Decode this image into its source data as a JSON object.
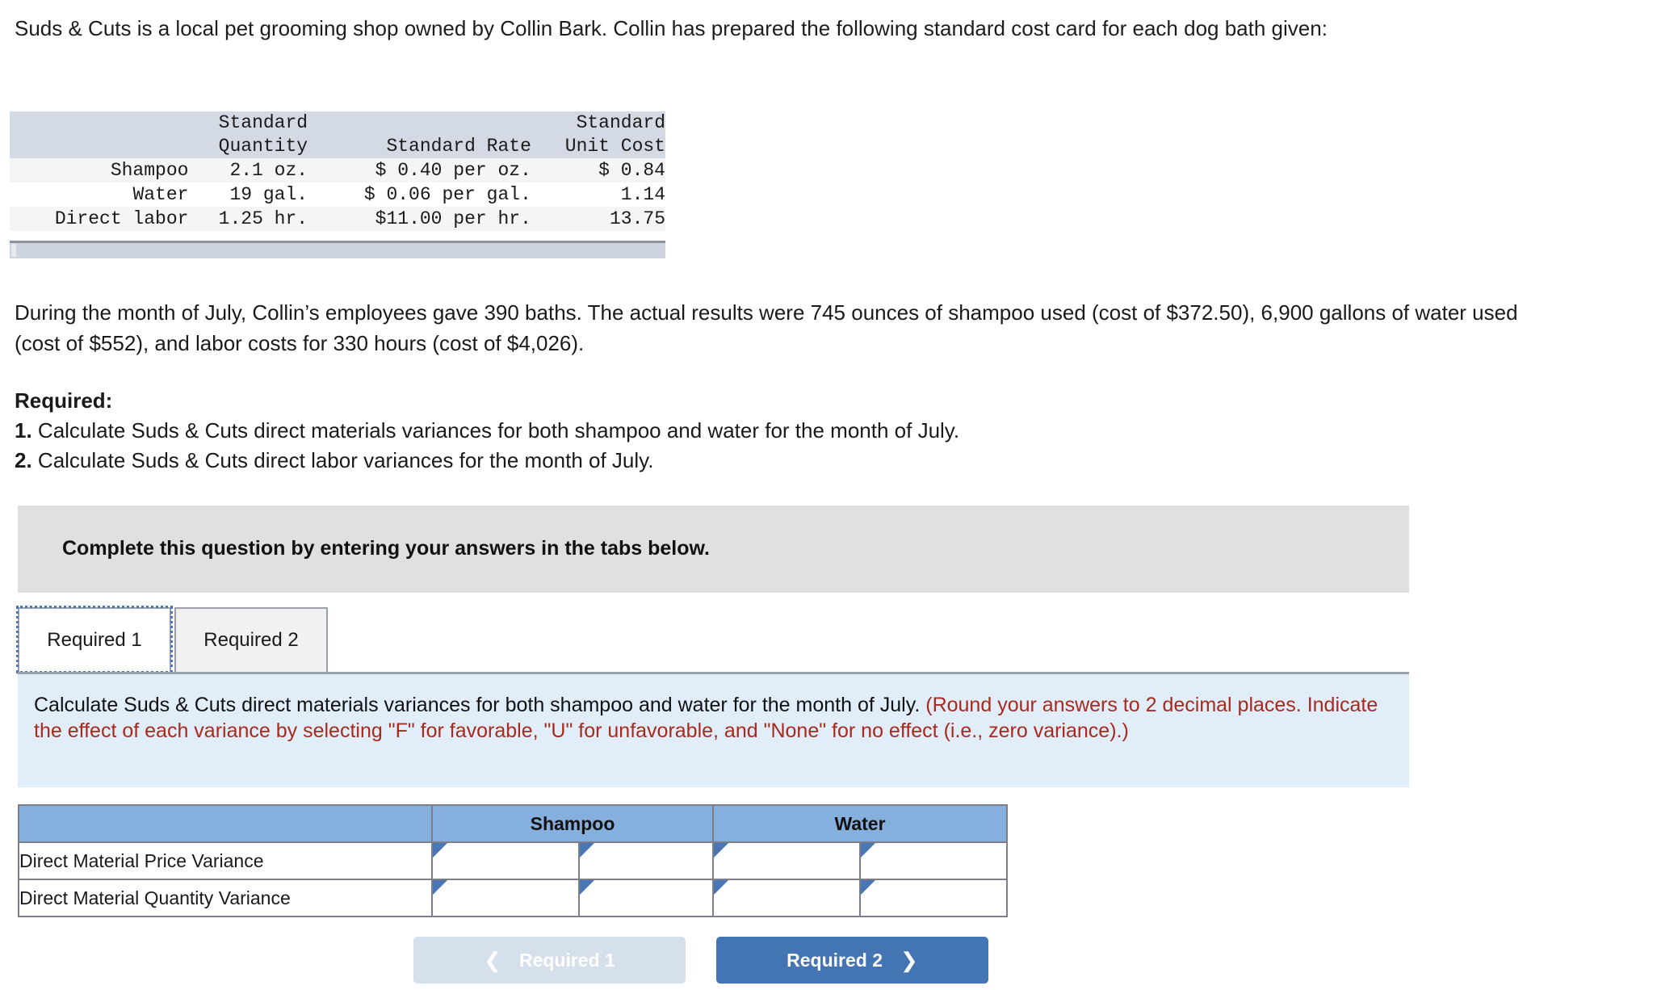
{
  "intro": {
    "paragraph": "Suds & Cuts is a local pet grooming shop owned by Collin Bark. Collin has prepared the following standard cost card for each dog bath given:"
  },
  "cost_card": {
    "headers": {
      "blank": "",
      "quantity_line1": "Standard",
      "quantity_line2": "Quantity",
      "rate": "Standard Rate",
      "unit_cost_line1": "Standard",
      "unit_cost_line2": "Unit Cost"
    },
    "rows": [
      {
        "label": "Shampoo",
        "quantity": "2.1 oz.",
        "rate": "$ 0.40 per oz.",
        "unit_cost": "$ 0.84"
      },
      {
        "label": "Water",
        "quantity": "19 gal.",
        "rate": "$ 0.06 per gal.",
        "unit_cost": "1.14"
      },
      {
        "label": "Direct labor",
        "quantity": "1.25 hr.",
        "rate": "$11.00 per hr.",
        "unit_cost": "13.75"
      }
    ]
  },
  "actuals": {
    "paragraph": "During the month of July, Collin’s employees gave 390 baths. The actual results were 745 ounces of shampoo used (cost of $372.50), 6,900 gallons of water used (cost of $552), and labor costs for 330 hours (cost of $4,026)."
  },
  "required": {
    "heading": "Required:",
    "item1_num": "1.",
    "item1_text": " Calculate Suds & Cuts direct materials variances for both shampoo and water for the month of July.",
    "item2_num": "2.",
    "item2_text": " Calculate Suds & Cuts direct labor variances for the month of July."
  },
  "banner": {
    "text": "Complete this question by entering your answers in the tabs below."
  },
  "tabs": {
    "active": "Required 1",
    "inactive": "Required 2"
  },
  "instruction": {
    "black_text": "Calculate Suds & Cuts direct materials variances for both shampoo and water for the month of July. ",
    "red_text": "(Round your answers to 2 decimal places. Indicate the effect of each variance by selecting \"F\" for favorable, \"U\" for unfavorable, and \"None\" for no effect (i.e., zero variance).)"
  },
  "answer_table": {
    "columns": [
      "",
      "Shampoo",
      "Water"
    ],
    "rows": [
      {
        "label": "Direct Material Price Variance",
        "shampoo_amount": "",
        "shampoo_effect": "",
        "water_amount": "",
        "water_effect": ""
      },
      {
        "label": "Direct Material Quantity Variance",
        "shampoo_amount": "",
        "shampoo_effect": "",
        "water_amount": "",
        "water_effect": ""
      }
    ]
  },
  "nav": {
    "prev_label": "Required 1",
    "prev_chevron": "❮",
    "next_label": "Required 2",
    "next_chevron": "❯"
  },
  "colors": {
    "header_blue": "#85afdc",
    "cell_border_blue": "#4a77b4",
    "banner_gray": "#e0e0e0",
    "panel_blue": "#e1edf9",
    "red_text": "#a72a1d",
    "next_button": "#4374b3",
    "prev_button": "#d5e0ec"
  }
}
